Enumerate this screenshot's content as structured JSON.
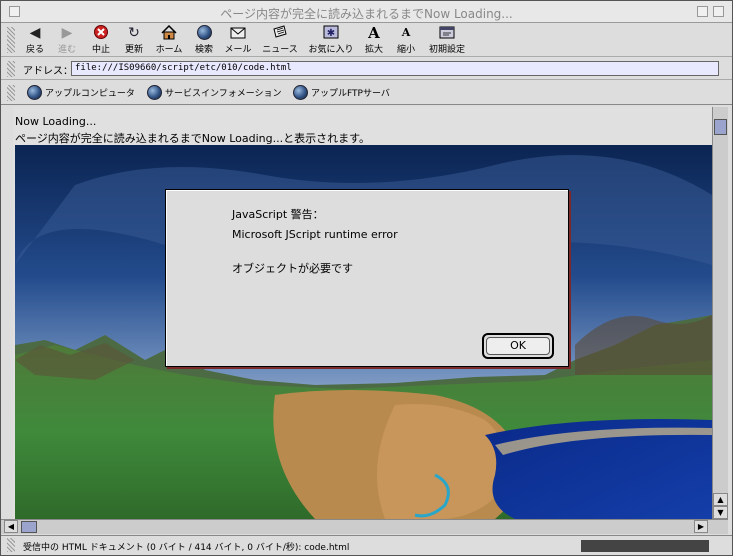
{
  "window": {
    "title": "ページ内容が完全に読み込まれるまでNow Loading..."
  },
  "toolbar": {
    "buttons": [
      {
        "label": "戻る",
        "icon": "back-arrow-icon"
      },
      {
        "label": "進む",
        "icon": "forward-arrow-icon"
      },
      {
        "label": "中止",
        "icon": "stop-icon"
      },
      {
        "label": "更新",
        "icon": "refresh-icon"
      },
      {
        "label": "ホーム",
        "icon": "home-icon"
      },
      {
        "label": "検索",
        "icon": "search-globe-icon"
      },
      {
        "label": "メール",
        "icon": "mail-icon"
      },
      {
        "label": "ニュース",
        "icon": "news-icon"
      },
      {
        "label": "お気に入り",
        "icon": "favorites-icon"
      },
      {
        "label": "拡大",
        "icon": "text-larger-icon"
      },
      {
        "label": "縮小",
        "icon": "text-smaller-icon"
      },
      {
        "label": "初期設定",
        "icon": "preferences-icon"
      }
    ]
  },
  "address": {
    "label": "アドレス：",
    "value": "file:///IS09660/script/etc/010/code.html"
  },
  "favorites": {
    "items": [
      {
        "label": "アップルコンピュータ"
      },
      {
        "label": "サービスインフォメーション"
      },
      {
        "label": "アップルFTPサーバ"
      }
    ]
  },
  "content": {
    "line1": "Now Loading...",
    "line2": "ページ内容が完全に読み込まれるまでNow Loading...と表示されます。"
  },
  "dialog": {
    "title": "JavaScript 警告：",
    "message1": "Microsoft JScript runtime error",
    "message2": "オブジェクトが必要です",
    "ok_label": "OK"
  },
  "status": {
    "text": "受信中の HTML ドキュメント (0 バイト / 414 バイト, 0 バイト/秒): code.html"
  },
  "colors": {
    "chrome": "#dddddd",
    "address_field": "#e8e8ff",
    "scroll_thumb": "#9aa4cc",
    "stop_red": "#cc2222"
  }
}
